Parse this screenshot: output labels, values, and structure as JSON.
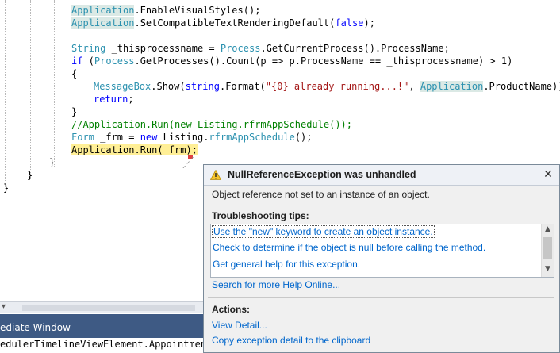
{
  "code": {
    "lines": {
      "l1": {
        "a": "Application",
        "b": ".EnableVisualStyles();"
      },
      "l2": {
        "a": "Application",
        "b": ".SetCompatibleTextRenderingDefault(",
        "c": "false",
        "d": ");"
      },
      "l3": {
        "a": "String",
        "b": " _thisprocessname = ",
        "c": "Process",
        "d": ".GetCurrentProcess().ProcessName;"
      },
      "l4": {
        "a": "if",
        "b": " (",
        "c": "Process",
        "d": ".GetProcesses().Count(p => p.ProcessName == _thisprocessname) > 1)"
      },
      "l5": {
        "a": "{"
      },
      "l6": {
        "a": "MessageBox",
        "b": ".Show(",
        "c": "string",
        "d": ".Format(",
        "e": "\"{0} already running...!\"",
        "f": ", ",
        "g": "Application",
        "h": ".ProductName));"
      },
      "l7": {
        "a": "return",
        "b": ";"
      },
      "l8": {
        "a": "}"
      },
      "l9": {
        "a": "//Application.Run(new Listing.rfrmAppSchedule());"
      },
      "l10": {
        "a": "Form",
        "b": " _frm = ",
        "c": "new",
        "d": " Listing.",
        "e": "rfrmAppSchedule",
        "f": "();"
      },
      "l11": {
        "a": "Application.Run(_frm);"
      },
      "l12": {
        "a": "}"
      },
      "l13": {
        "a": "}"
      },
      "l14": {
        "a": "}"
      }
    }
  },
  "bottom": {
    "strip_arrow": "▾",
    "panel_title": "ediate Window",
    "panel_text": "edulerTimelineViewElement.Appointment"
  },
  "exception": {
    "title": "NullReferenceException was unhandled",
    "close": "✕",
    "message": "Object reference not set to an instance of an object.",
    "tips_header": "Troubleshooting tips:",
    "tips": [
      "Use the \"new\" keyword to create an object instance.",
      "Check to determine if the object is null before calling the method.",
      "Get general help for this exception."
    ],
    "search_link": "Search for more Help Online...",
    "actions_header": "Actions:",
    "actions": [
      "View Detail...",
      "Copy exception detail to the clipboard"
    ],
    "scroll_up": "▲",
    "scroll_down": "▼"
  },
  "colors": {
    "keyword": "#0000ff",
    "type": "#2b91af",
    "string": "#a31515",
    "comment": "#008000",
    "current_statement": "#ffef96",
    "link": "#0066cc",
    "panel_tab": "#3e5a84"
  },
  "icons": {
    "warning": "warning-icon",
    "close": "close-icon",
    "scroll_up": "scroll-up-arrow-icon",
    "scroll_down": "scroll-down-arrow-icon",
    "error_marker": "error-squiggle-icon"
  }
}
